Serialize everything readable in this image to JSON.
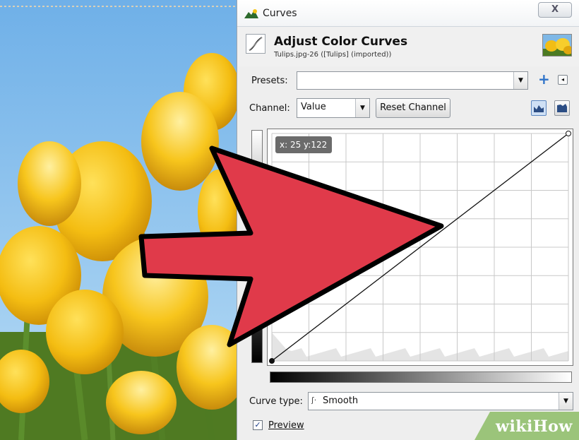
{
  "window": {
    "title": "Curves",
    "close_label": "X"
  },
  "header": {
    "title": "Adjust Color Curves",
    "subtitle": "Tulips.jpg-26 ([Tulips] (imported))"
  },
  "presets": {
    "label": "Presets:",
    "value": ""
  },
  "channel": {
    "label": "Channel:",
    "value": "Value",
    "reset_label": "Reset Channel"
  },
  "graph": {
    "pointer_readout": "x: 25 y:122",
    "curve_points": [
      [
        0,
        0
      ],
      [
        255,
        255
      ]
    ],
    "range": [
      0,
      255
    ]
  },
  "curve_type": {
    "label": "Curve type:",
    "value": "Smooth"
  },
  "preview": {
    "label": "Preview",
    "checked": true
  },
  "watermark": {
    "text": "wikiHow"
  },
  "icons": [
    "app-icon",
    "curves-tool-icon",
    "image-thumbnail",
    "add-preset-icon",
    "preset-menu-icon",
    "linear-histogram-icon",
    "log-histogram-icon",
    "red-arrow-overlay"
  ]
}
